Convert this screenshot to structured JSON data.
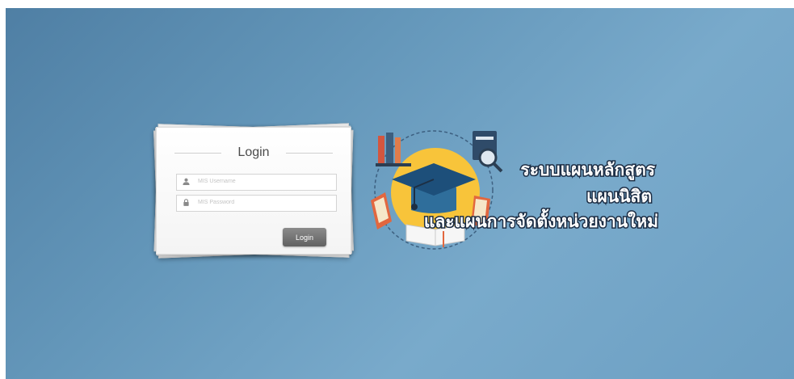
{
  "login": {
    "title": "Login",
    "username_placeholder": "MIS Username",
    "password_placeholder": "MIS Password",
    "button_label": "Login"
  },
  "logo": {
    "lines": [
      "ระบบแผนหลักสูตร",
      "แผนนิสิต",
      "และแผนการจัดตั้งหน่วยงานใหม่"
    ]
  },
  "colors": {
    "background_dark": "#4f7fa4",
    "background_light": "#79aacb",
    "logo_circle": "#f8c43a",
    "button": "#6f6f6f"
  }
}
